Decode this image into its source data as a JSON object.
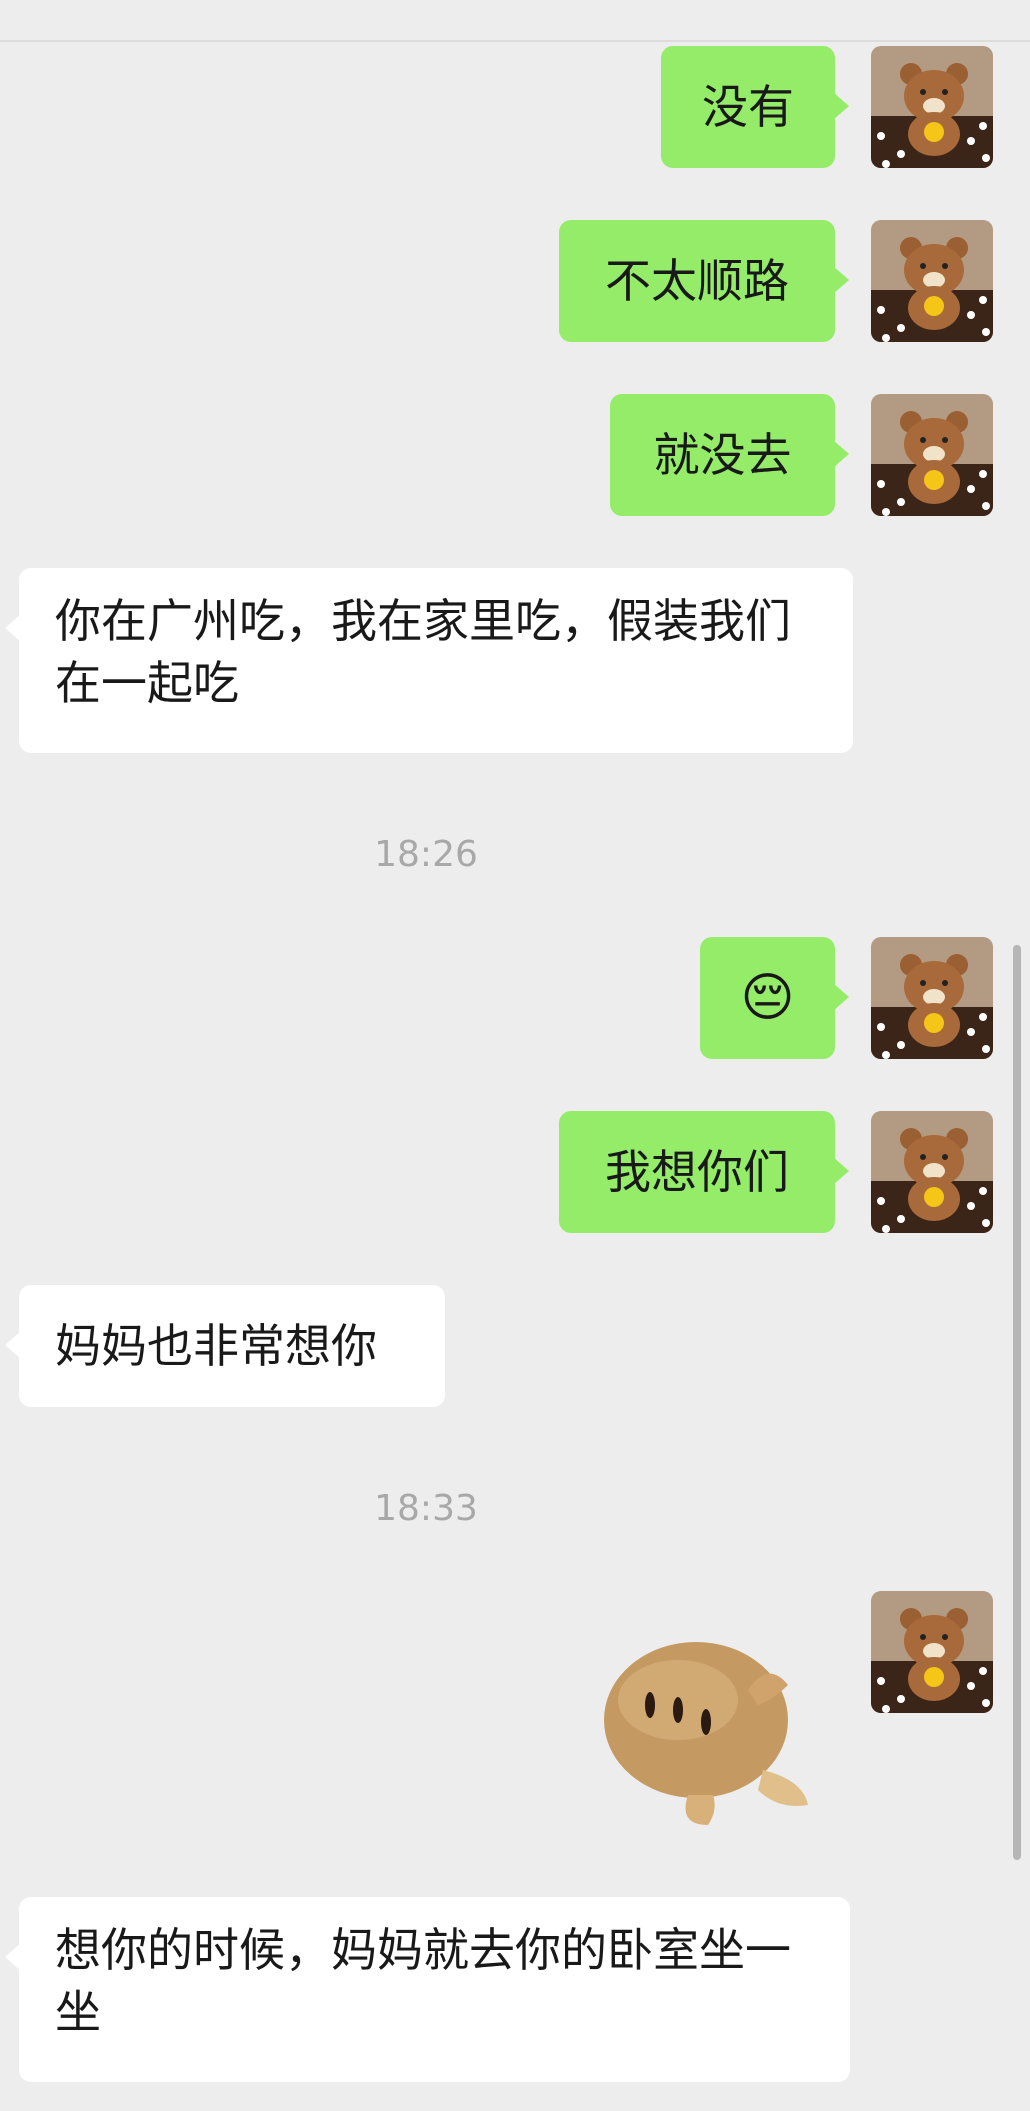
{
  "chat": {
    "messages": [
      {
        "side": "sent",
        "text": "没有"
      },
      {
        "side": "sent",
        "text": "不太顺路"
      },
      {
        "side": "sent",
        "text": "就没去"
      },
      {
        "side": "received",
        "text": "你在广州吃，我在家里吃，假装我们在一起吃"
      },
      {
        "timestamp": "18:26"
      },
      {
        "side": "sent",
        "type": "emoji",
        "emoji": "😔",
        "icon": "pensive-face-icon"
      },
      {
        "side": "sent",
        "text": "我想你们"
      },
      {
        "side": "received",
        "text": "妈妈也非常想你"
      },
      {
        "timestamp": "18:33"
      },
      {
        "side": "sent",
        "type": "sticker",
        "icon": "potato-sticker-icon"
      },
      {
        "side": "received",
        "text": "想你的时候，妈妈就去你的卧室坐一坐"
      }
    ],
    "self_avatar": "teddy-bear-avatar-icon"
  },
  "colors": {
    "background": "#ededed",
    "sent_bubble": "#95ec69",
    "received_bubble": "#ffffff",
    "timestamp_text": "#a8a8a8"
  }
}
